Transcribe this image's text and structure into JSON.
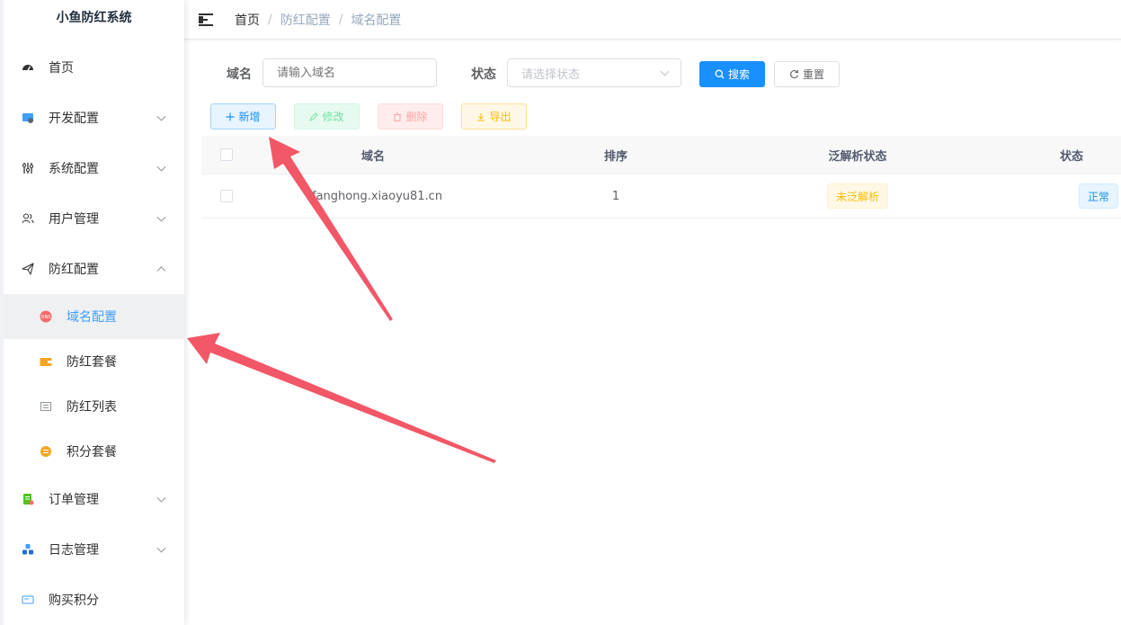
{
  "app": {
    "title": "小鱼防红系统"
  },
  "sidebar": {
    "items": [
      {
        "label": "首页",
        "icon": "dashboard-icon",
        "expandable": false
      },
      {
        "label": "开发配置",
        "icon": "monitor-icon",
        "expandable": true
      },
      {
        "label": "系统配置",
        "icon": "settings-sliders-icon",
        "expandable": true
      },
      {
        "label": "用户管理",
        "icon": "users-icon",
        "expandable": true
      },
      {
        "label": "防红配置",
        "icon": "paper-plane-icon",
        "expandable": true,
        "expanded": true,
        "children": [
          {
            "label": "域名配置",
            "icon": "dns-icon",
            "active": true
          },
          {
            "label": "防红套餐",
            "icon": "wallet-icon"
          },
          {
            "label": "防红列表",
            "icon": "list-icon"
          },
          {
            "label": "积分套餐",
            "icon": "coins-icon"
          }
        ]
      },
      {
        "label": "订单管理",
        "icon": "order-icon",
        "expandable": true
      },
      {
        "label": "日志管理",
        "icon": "log-cubes-icon",
        "expandable": true
      },
      {
        "label": "购买积分",
        "icon": "card-icon",
        "expandable": false
      }
    ]
  },
  "breadcrumb": [
    "首页",
    "防红配置",
    "域名配置"
  ],
  "search": {
    "domain_label": "域名",
    "domain_placeholder": "请输入域名",
    "status_label": "状态",
    "status_placeholder": "请选择状态",
    "search_button": "搜索",
    "reset_button": "重置"
  },
  "toolbar": {
    "add": "新增",
    "edit": "修改",
    "delete": "删除",
    "export": "导出"
  },
  "table": {
    "columns": [
      "域名",
      "排序",
      "泛解析状态",
      "状态"
    ],
    "rows": [
      {
        "domain": "fanghong.xiaoyu81.cn",
        "sort": "1",
        "wildcard_status": "未泛解析",
        "status": "正常"
      }
    ]
  },
  "colors": {
    "primary": "#1890ff",
    "annotation_arrow": "#f25767",
    "warning": "#ffba00"
  }
}
